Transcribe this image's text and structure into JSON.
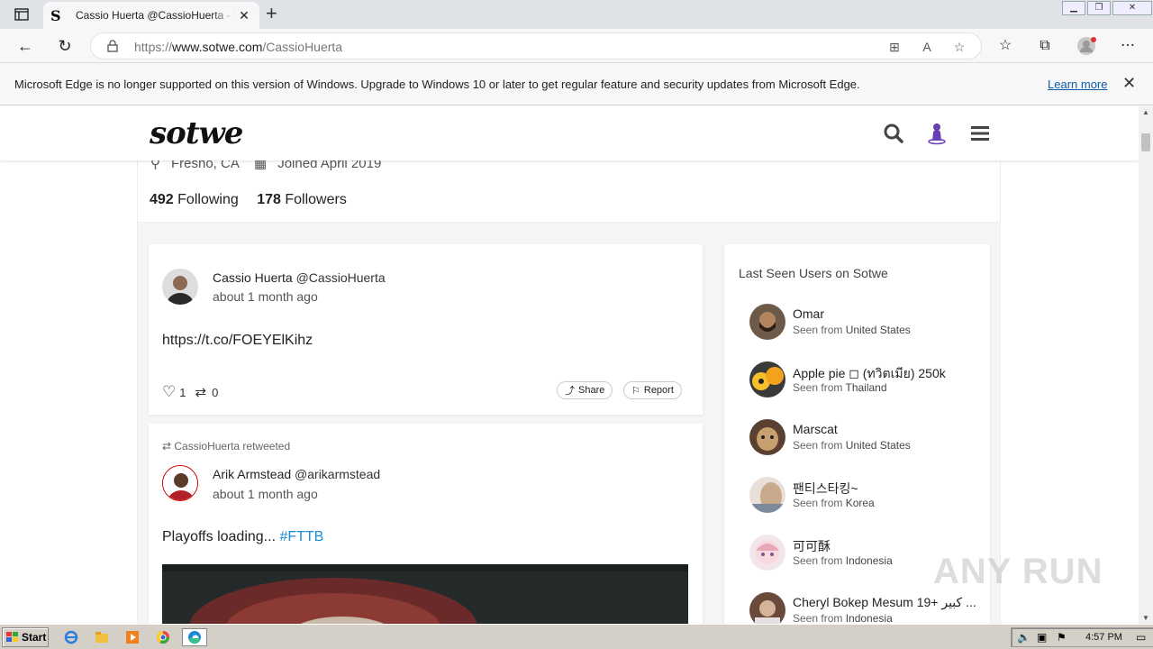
{
  "browser": {
    "tab_title": "Cassio Huerta @CassioHuerta - T",
    "url_prefix": "https://",
    "url_domain": "www.sotwe.com",
    "url_path": "/CassioHuerta",
    "infobar_message": "Microsoft Edge is no longer supported on this version of Windows. Upgrade to Windows 10 or later to get regular feature and security updates from Microsoft Edge.",
    "infobar_link": "Learn more"
  },
  "site": {
    "logo": "sotwe"
  },
  "profile": {
    "location": "Fresno, CA",
    "joined": "Joined April 2019",
    "following_count": "492",
    "following_label": "Following",
    "followers_count": "178",
    "followers_label": "Followers"
  },
  "posts": [
    {
      "name": "Cassio Huerta",
      "handle": "@CassioHuerta",
      "time": "about 1 month ago",
      "text": "https://t.co/FOEYElKihz",
      "likes": "1",
      "retweets": "0",
      "share_label": "Share",
      "report_label": "Report"
    },
    {
      "retweeted_by": "CassioHuerta retweeted",
      "name": "Arik Armstead",
      "handle": "@arikarmstead",
      "time": "about 1 month ago",
      "text": "Playoffs loading... ",
      "hashtag": "#FTTB"
    }
  ],
  "sidebar": {
    "title": "Last Seen Users on Sotwe",
    "seen_prefix": "Seen from",
    "users": [
      {
        "name": "Omar",
        "country": "United States"
      },
      {
        "name": "Apple pie ◻ (ทวิตเมีย) 250k",
        "country": "Thailand"
      },
      {
        "name": "Marscat",
        "country": "United States"
      },
      {
        "name": "팬티스타킹~",
        "country": "Korea"
      },
      {
        "name": "可可酥",
        "country": "Indonesia"
      },
      {
        "name": "Cheryl Bokep Mesum 19+ كبير ...",
        "country": "Indonesia"
      }
    ]
  },
  "watermark": "ANY RUN",
  "taskbar": {
    "start_label": "Start",
    "clock": "4:57 PM"
  }
}
